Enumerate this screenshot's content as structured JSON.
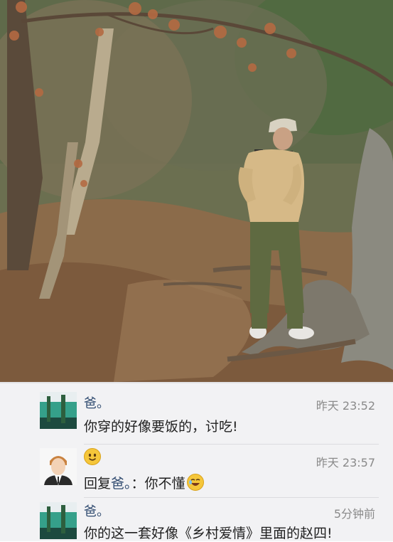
{
  "comments": [
    {
      "author": "爸。",
      "time": "昨天 23:52",
      "text": "你穿的好像要饭的，讨吃!",
      "avatar": "lake-avatar"
    },
    {
      "author_icon": "smiling-face-emoji-icon",
      "time": "昨天 23:57",
      "reply_prefix": "回复",
      "reply_to": "爸。",
      "reply_body": "：你不懂",
      "trailing_icon": "laughing-face-emoji-icon",
      "avatar": "cartoon-man-avatar"
    },
    {
      "author": "爸。",
      "time": "5分钟前",
      "text": "你的这一套好像《乡村爱情》里面的赵四!",
      "avatar": "lake-avatar"
    }
  ],
  "colors": {
    "name": "#2f4a6f",
    "time": "#8a8a8a",
    "background": "#f2f2f4"
  }
}
